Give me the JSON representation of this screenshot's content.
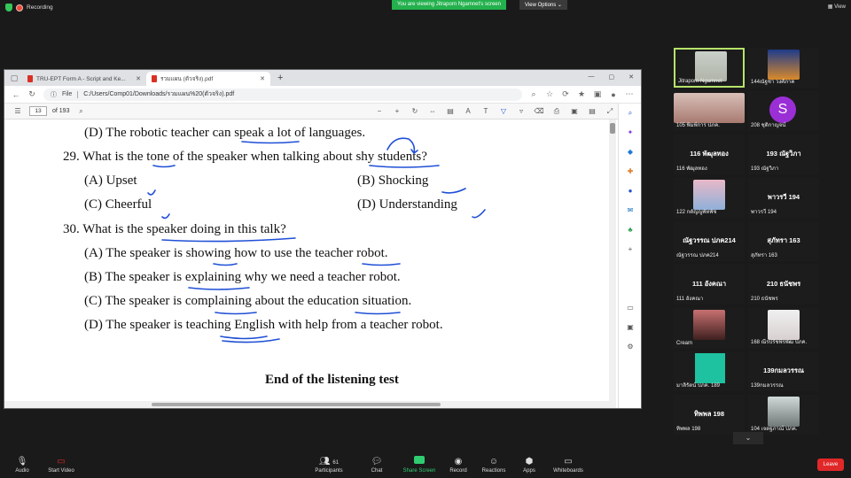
{
  "top": {
    "recording": "Recording",
    "viewing": "You are viewing Jitraporn Ngamnet's screen",
    "view_options": "View Options",
    "view": "View"
  },
  "browser": {
    "tabs": [
      {
        "label": "TRU-EPT Form A - Script and Ke..."
      },
      {
        "label": "รวมแผน (ตัวจริง).pdf"
      }
    ],
    "address_scheme": "File",
    "address": "C:/Users/Comp01/Downloads/รวมแผน%20(ตัวจริง).pdf",
    "page_current": "13",
    "page_total": "of 193"
  },
  "doc": {
    "lines": [
      {
        "text": "(D) The robotic teacher can speak a lot of languages."
      },
      {
        "text": "29. What is the tone of the speaker when talking about shy students?"
      },
      {
        "text": "(A) Upset"
      },
      {
        "text": "(B) Shocking"
      },
      {
        "text": "(C) Cheerful"
      },
      {
        "text": "(D) Understanding"
      },
      {
        "text": "30. What is the speaker doing in this talk?"
      },
      {
        "text": "(A) The speaker is showing how to use the teacher robot."
      },
      {
        "text": "(B) The speaker is explaining why we need a teacher robot."
      },
      {
        "text": "(C) The speaker is complaining about the education situation."
      },
      {
        "text": "(D) The speaker is teaching English with help from a teacher robot."
      },
      {
        "text": "End of the listening test"
      }
    ]
  },
  "gallery": {
    "tiles": [
      {
        "name": "Jitraporn Ngamnet"
      },
      {
        "name": "144ณัฐชา วงศ์ภาค"
      },
      {
        "name": "105 พิมพ์การ ปภค."
      },
      {
        "name": "208 ชุติกาญจน์"
      },
      {
        "big": "116 พัฒุลทอง",
        "name": "116 พัฒุลทอง"
      },
      {
        "big": "193 ณัฐวิภา",
        "name": "193 ณัฐวิภา"
      },
      {
        "name": "122 กตัญญูพัทพัช"
      },
      {
        "big": "พาวรวี 194",
        "name": "พาวรวี 194"
      },
      {
        "big": "ณัฐวรรณ ปภค214",
        "name": "ณัฐวรรณ ปภค214"
      },
      {
        "big": "สุภัทรา 163",
        "name": "สุภัทรา 163"
      },
      {
        "big": "111 อังคณา",
        "name": "111 อังคณา"
      },
      {
        "big": "210 ธนัชพร",
        "name": "210 ธนัชพร"
      },
      {
        "name": "Cream"
      },
      {
        "name": "168 ณีรปรีชพีรพัฒ ปภค."
      },
      {
        "name": "มาลิรัตน์ ปภค. 189"
      },
      {
        "big": "139กมลวรรณ",
        "name": "139กมลวรรณ"
      },
      {
        "big": "ทิพพล 198",
        "name": "ทิพพล 198"
      },
      {
        "name": "104 เจตฐภาณ์ ปภค."
      }
    ],
    "s_letter": "S"
  },
  "bottom": {
    "audio": "Audio",
    "video": "Start Video",
    "participants": "Participants",
    "participants_count": "61",
    "chat": "Chat",
    "share": "Share Screen",
    "record": "Record",
    "reactions": "Reactions",
    "apps": "Apps",
    "whiteboards": "Whiteboards",
    "leave": "Leave"
  },
  "colors": {
    "ink": "#1f4fd6",
    "zoom_green": "#23b14d",
    "leave_red": "#e02828"
  }
}
